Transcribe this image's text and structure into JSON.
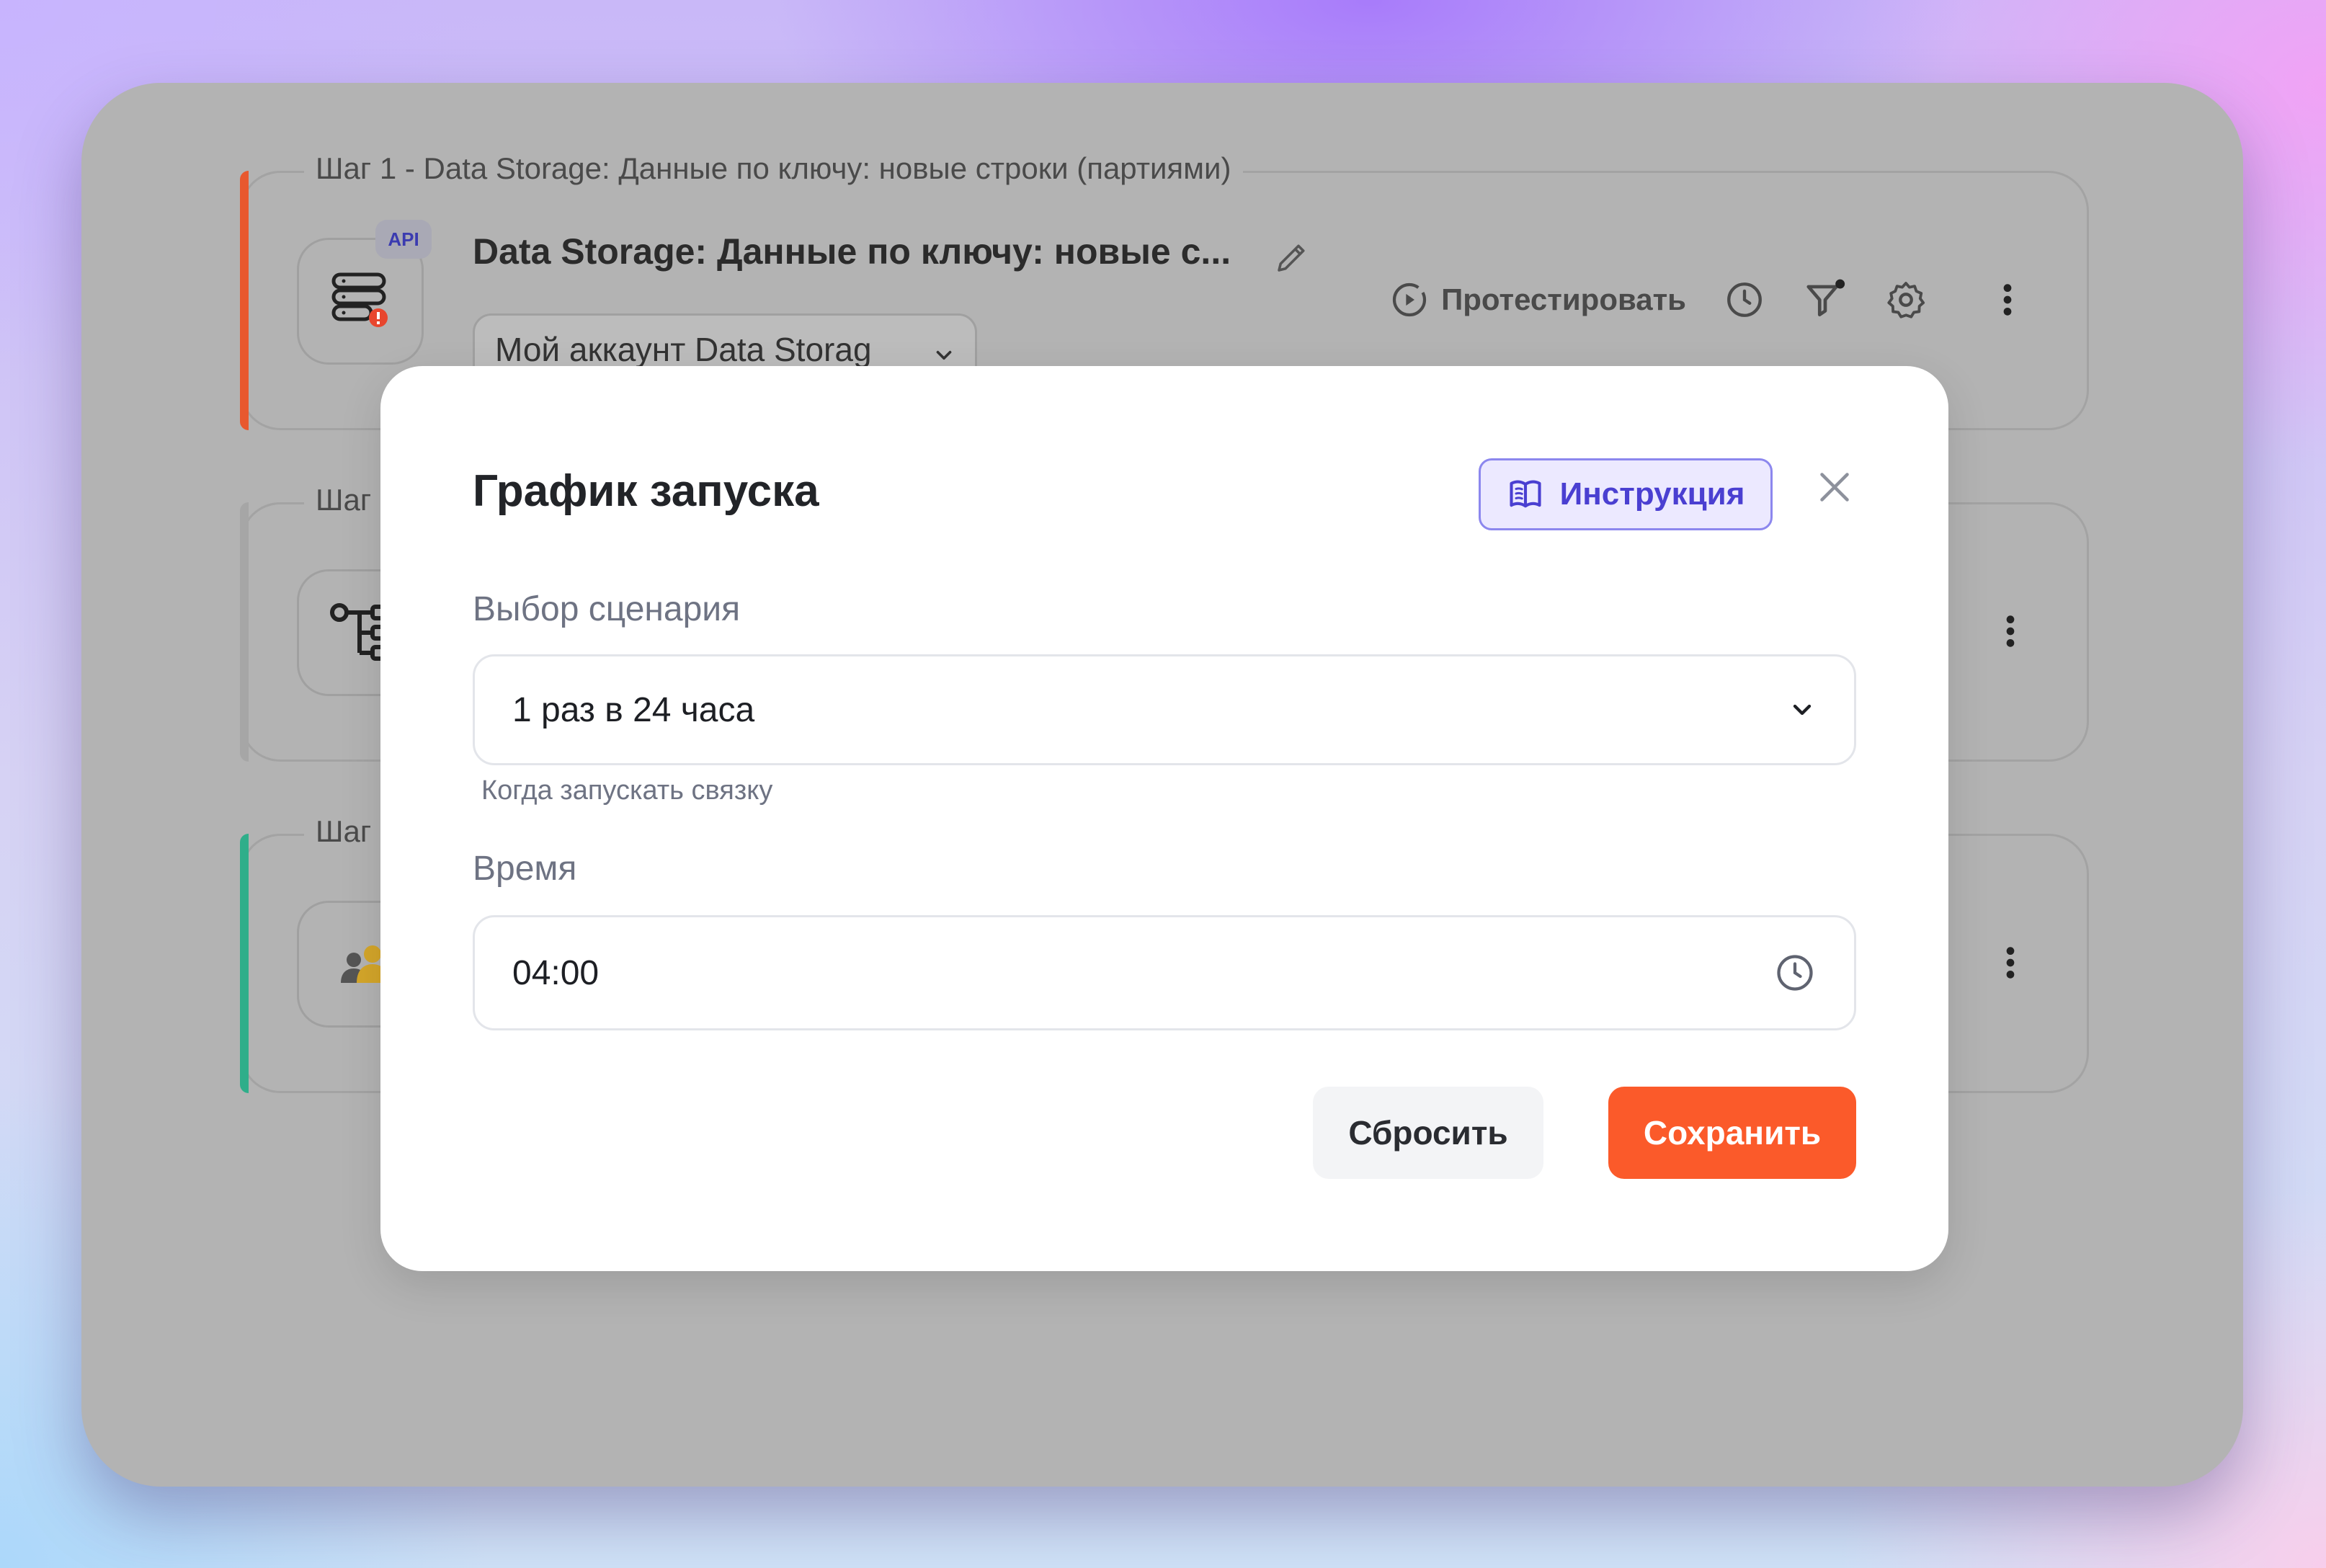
{
  "steps": [
    {
      "legend": "Шаг 1 - Data Storage: Данные по ключу: новые строки (партиями)",
      "title": "Data Storage: Данные по ключу: новые с...",
      "badge": "API",
      "account": "Мой аккаунт Data Storag",
      "test_label": "Протестировать",
      "accent": "#e8582e"
    },
    {
      "legend": "Шаг 2",
      "accent": "#a6a6a6"
    },
    {
      "legend": "Шаг 3",
      "accent": "#2fae8a"
    }
  ],
  "modal": {
    "title": "График запуска",
    "instruction_label": "Инструкция",
    "scenario": {
      "label": "Выбор сценария",
      "value": "1 раз в 24 часа",
      "hint": "Когда запускать связку"
    },
    "time": {
      "label": "Время",
      "value": "04:00"
    },
    "reset_label": "Сбросить",
    "save_label": "Сохранить"
  },
  "colors": {
    "accent_orange": "#fb5a2a",
    "instruction_purple": "#4a3fd1",
    "step1_accent": "#e8582e",
    "step3_accent": "#2fae8a"
  },
  "icons": [
    "database-icon",
    "flow-icon",
    "users-icon",
    "pencil-icon",
    "play-circle-icon",
    "clock-icon",
    "filter-icon",
    "gear-icon",
    "kebab-icon",
    "book-icon",
    "close-icon",
    "chevron-down-icon"
  ]
}
